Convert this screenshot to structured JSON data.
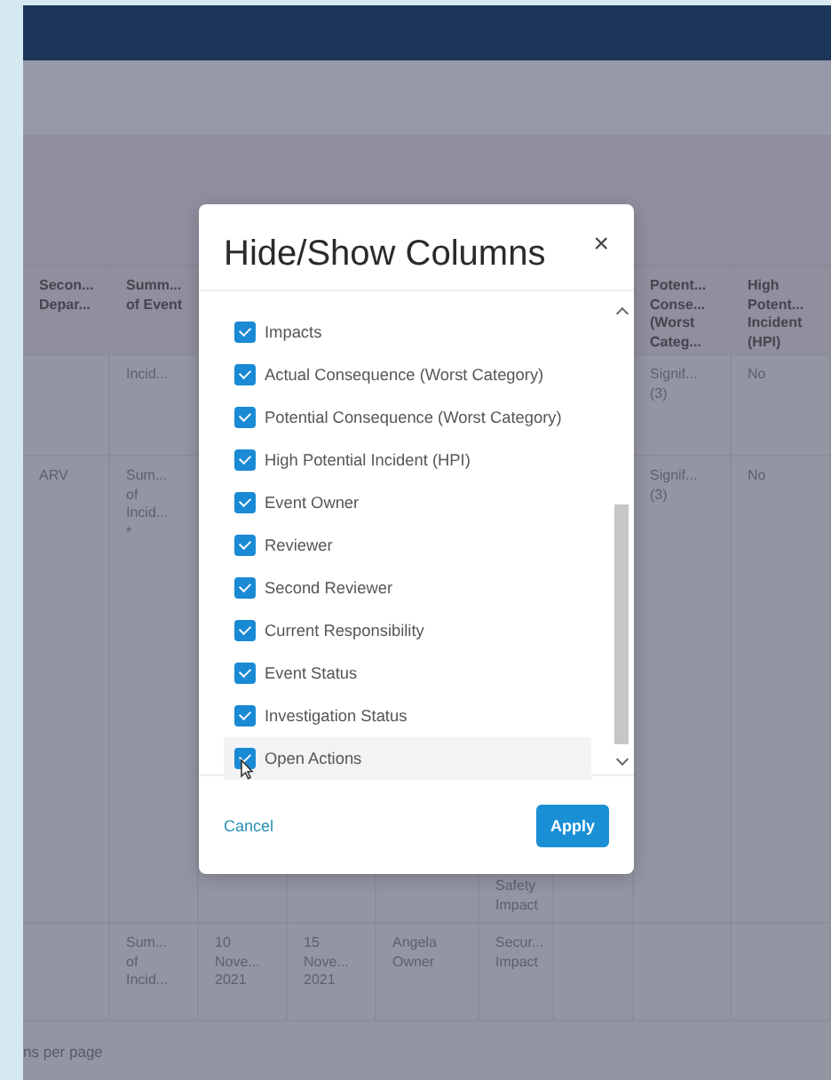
{
  "table": {
    "columns": [
      {
        "heading": "Secon...\nDepar..."
      },
      {
        "heading": "Summ...\nof Event"
      },
      {},
      {},
      {},
      {},
      {},
      {
        "heading": "Potent...\nConse...\n(Worst\nCateg..."
      },
      {
        "heading": "High\nPotent...\nIncident\n(HPI)"
      }
    ],
    "rows": [
      [
        null,
        "Incid...",
        null,
        null,
        null,
        null,
        null,
        "Signif...\n(3)",
        "No"
      ],
      [
        "ARV",
        "Sum...\nof\nIncid...\n*",
        null,
        null,
        null,
        "Safety\nImpact",
        null,
        "Signif...\n(3)",
        "No"
      ],
      [
        null,
        "Sum...\nof\nIncid...",
        "10\nNove...\n2021",
        "15\nNove...\n2021",
        "Angela\nOwner",
        "Secur...\nImpact",
        null,
        null,
        null
      ]
    ]
  },
  "footer": {
    "page_size_label": "ns per page"
  },
  "dialog": {
    "title": "Hide/Show Columns",
    "close": "×",
    "items": [
      {
        "label": "Impacts",
        "checked": true,
        "hovered": false
      },
      {
        "label": "Actual Consequence (Worst Category)",
        "checked": true,
        "hovered": false
      },
      {
        "label": "Potential Consequence (Worst Category)",
        "checked": true,
        "hovered": false
      },
      {
        "label": "High Potential Incident (HPI)",
        "checked": true,
        "hovered": false
      },
      {
        "label": "Event Owner",
        "checked": true,
        "hovered": false
      },
      {
        "label": "Reviewer",
        "checked": true,
        "hovered": false
      },
      {
        "label": "Second Reviewer",
        "checked": true,
        "hovered": false
      },
      {
        "label": "Current Responsibility",
        "checked": true,
        "hovered": false
      },
      {
        "label": "Event Status",
        "checked": true,
        "hovered": false
      },
      {
        "label": "Investigation Status",
        "checked": true,
        "hovered": false
      },
      {
        "label": "Open Actions",
        "checked": true,
        "hovered": true
      }
    ],
    "cancel": "Cancel",
    "apply": "Apply"
  }
}
